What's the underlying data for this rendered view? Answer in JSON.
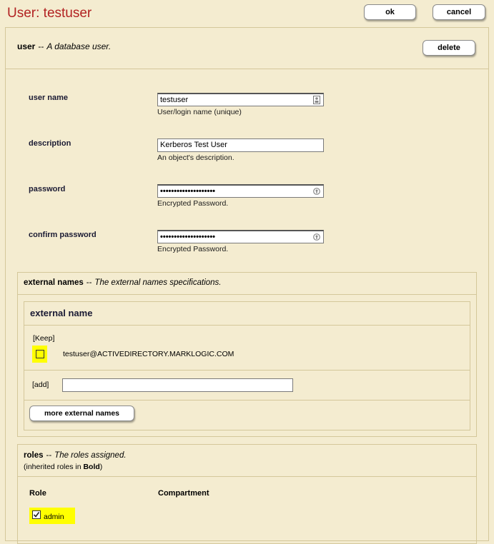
{
  "header": {
    "title": "User: testuser",
    "ok_label": "ok",
    "cancel_label": "cancel"
  },
  "user_section": {
    "name": "user",
    "dash": "--",
    "description": "A database user.",
    "delete_label": "delete"
  },
  "fields": {
    "user_name": {
      "label": "user name",
      "value": "testuser",
      "hint": "User/login name (unique)"
    },
    "description": {
      "label": "description",
      "value": "Kerberos Test User",
      "hint": "An object's description."
    },
    "password": {
      "label": "password",
      "value": "••••••••••••••••••••",
      "hint": "Encrypted Password."
    },
    "confirm_password": {
      "label": "confirm password",
      "value": "••••••••••••••••••••",
      "hint": "Encrypted Password."
    }
  },
  "external_names": {
    "name": "external names",
    "dash": "--",
    "description": "The external names specifications.",
    "inner_title": "external name",
    "keep_label": "[Keep]",
    "entry_value": "testuser@ACTIVEDIRECTORY.MARKLOGIC.COM",
    "entry_checked": false,
    "add_label": "[add]",
    "add_value": "",
    "more_label": "more external names"
  },
  "roles": {
    "name": "roles",
    "dash": "--",
    "description": "The roles assigned.",
    "note_prefix": "(inherited roles in ",
    "note_bold": "Bold",
    "note_suffix": ")",
    "col_role": "Role",
    "col_compartment": "Compartment",
    "items": [
      {
        "label": "admin",
        "checked": true
      }
    ]
  },
  "colors": {
    "background": "#f4ecd0",
    "title": "#b22222",
    "highlight": "#ffff00",
    "border": "#d4c79a"
  }
}
